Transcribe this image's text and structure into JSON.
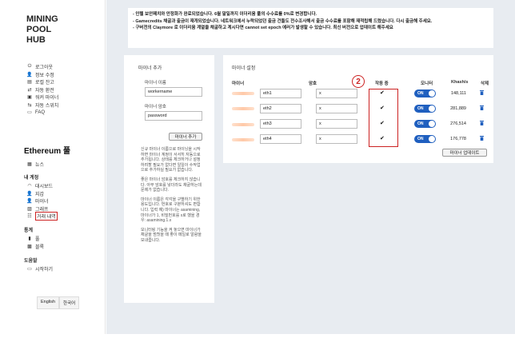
{
  "logo": {
    "line1": "MINING",
    "line2": "POOL",
    "line3": "HUB"
  },
  "top_nav": [
    {
      "icon": "power-icon",
      "label": "로그아웃"
    },
    {
      "icon": "user-icon",
      "label": "정보 수정"
    },
    {
      "icon": "deposit-icon",
      "label": "로컬 잔고"
    },
    {
      "icon": "exchange-icon",
      "label": "자동 환전"
    },
    {
      "icon": "worker-icon",
      "label": "워커 마이너"
    },
    {
      "icon": "switch-icon",
      "label": "자동 스위치"
    },
    {
      "icon": "faq-icon",
      "label": "FAQ"
    }
  ],
  "pool_title": "Ethereum 풀",
  "pool_nav": [
    {
      "icon": "news-icon",
      "label": "뉴스"
    }
  ],
  "account_title": "내 계정",
  "account_nav": [
    {
      "icon": "dashboard-icon",
      "label": "대시보드"
    },
    {
      "icon": "user-icon",
      "label": "지갑"
    },
    {
      "icon": "user-icon",
      "label": "마이너"
    },
    {
      "icon": "graph-icon",
      "label": "그래프"
    },
    {
      "icon": "transactions-icon",
      "label": "거래 내역"
    }
  ],
  "stats_title": "통계",
  "stats_nav": [
    {
      "icon": "pool-icon",
      "label": "풀"
    },
    {
      "icon": "blocks-icon",
      "label": "블록"
    }
  ],
  "help_title": "도움말",
  "help_nav": [
    {
      "icon": "start-icon",
      "label": "시작하기"
    }
  ],
  "languages": [
    "English",
    "한국어"
  ],
  "notice": {
    "line1": "- 인텔 보안패치와 안정화가 완료되었습니다. 6월 말일까지 이더리움 풀의 수수료를 0%로 변경합니다.",
    "line2": "- Gamecredits 채굴과 출금이 재개되었습니다. 네트워크에서 누락되었던 출금 건들도 전수조사해서 출금 수수료를 포함해 재적립해 드렸습니다. 다시 출금해 주세요.",
    "line3": "- 구버전의 Claymore 로 이더리움 계열을 채굴하고 계시다면 cannot set epoch 에러가 발생할 수 있습니다. 최신 버전으로 업데이트 해주세요"
  },
  "add_miner": {
    "title": "마이너 추가",
    "name_label": "마이너 이름",
    "name_value": "workername",
    "password_label": "마이너 암호",
    "password_value": "password",
    "add_button": "마이너 추가",
    "help": [
      "신규 마이너 이름으로 마이닝을 시작하면 마이너 계정이 서서히 자동으로 추가됩니다. 상태를 체크하거나 설정하려할 필요가 없다면 일일이 수작업으로 추가하실 필요가 없습니다.",
      "좋은 마이너 암호를 체크하지 않습니다. 아무 암호를 넣더라도 채굴하는데 문제가 없습니다.",
      "마이너 이름은 각각을 구별하기 위한 용도입니다. 번호로 구분하셔도 편합니다. 입력 예) 마이너는 asamining, 마이너가 1, 비밀번호를 x로 했을 경우: asamining.1.x",
      "모니터링 기능을 켜 놓으면 마이너가 채굴을 멈췄을 때 좋이 메일로 알람을 보내줍니다."
    ]
  },
  "miner_settings": {
    "title": "마이너 설정",
    "columns": {
      "miner": "마이너",
      "password": "암호",
      "shares": "작동 중",
      "monitor": "모니터",
      "rate": "Khash/s",
      "delete": "삭제"
    },
    "rows": [
      {
        "name": "eth1",
        "password": "x",
        "monitor": "ON",
        "rate": "148,111"
      },
      {
        "name": "eth2",
        "password": "x",
        "monitor": "ON",
        "rate": "281,889"
      },
      {
        "name": "eth3",
        "password": "x",
        "monitor": "ON",
        "rate": "276,514"
      },
      {
        "name": "eth4",
        "password": "x",
        "monitor": "ON",
        "rate": "176,778"
      }
    ],
    "update_button": "마이너 업데이트"
  },
  "annotation": {
    "number": "2",
    "color": "#cc2222"
  },
  "colors": {
    "toggle": "#1f5fbf",
    "trash": "#1f5fbf",
    "background": "#e8ecf1"
  }
}
